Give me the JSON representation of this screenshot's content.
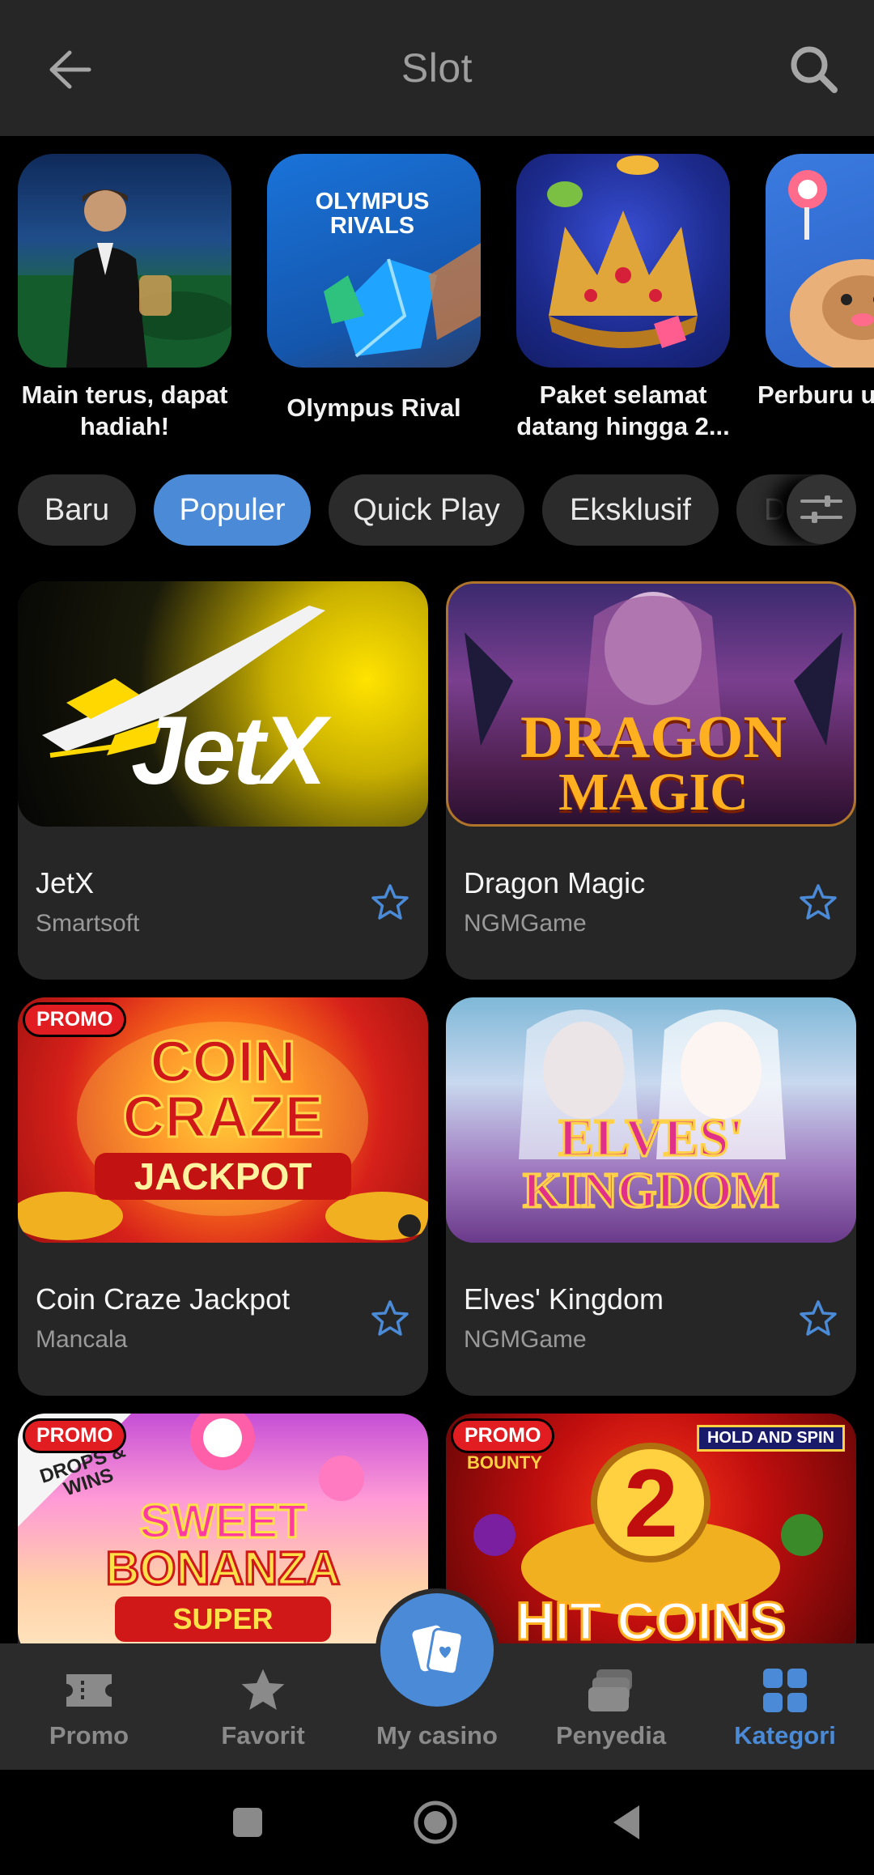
{
  "header": {
    "title": "Slot",
    "back_icon": "arrow-left-icon",
    "search_icon": "search-icon"
  },
  "promos": [
    {
      "label": "Main terus, dapat hadiah!"
    },
    {
      "label": "Olympus Rival",
      "art_text": "OLYMPUS RIVALS"
    },
    {
      "label": "Paket selamat datang hingga 2..."
    },
    {
      "label": "Perburu untuk pu"
    }
  ],
  "chips": [
    {
      "label": "Baru",
      "active": false
    },
    {
      "label": "Populer",
      "active": true
    },
    {
      "label": "Quick Play",
      "active": false
    },
    {
      "label": "Eksklusif",
      "active": false
    },
    {
      "label": "D",
      "active": false
    }
  ],
  "filter_icon": "sliders-icon",
  "games": [
    {
      "name": "JetX",
      "provider": "Smartsoft",
      "promo": false,
      "art_text": "JetX"
    },
    {
      "name": "Dragon Magic",
      "provider": "NGMGame",
      "promo": false,
      "art_line1": "DRAGON",
      "art_line2": "MAGIC"
    },
    {
      "name": "Coin Craze Jackpot",
      "provider": "Mancala",
      "promo": true,
      "art_line1": "COIN",
      "art_line2": "CRAZE",
      "art_line3": "JACKPOT"
    },
    {
      "name": "Elves' Kingdom",
      "provider": "NGMGame",
      "promo": false,
      "art_line1": "ELVES'",
      "art_line2": "KINGDOM"
    },
    {
      "name": "",
      "provider": "",
      "promo": true,
      "art_line1": "SWEET",
      "art_line2": "BONANZA",
      "art_line3": "SUPER SCATTER",
      "art_tag": "DROPS & WINS"
    },
    {
      "name": "",
      "provider": "",
      "promo": true,
      "art_line1": "HIT COINS",
      "art_tag": "HOLD AND SPIN",
      "art_tag2": "BOUNTY",
      "art_num": "2"
    }
  ],
  "promo_badge": "PROMO",
  "colors": {
    "accent": "#4a8ad6",
    "promo": "#e11d22",
    "card": "#262626",
    "header": "#262626"
  },
  "nav": [
    {
      "label": "Promo",
      "icon": "ticket-icon",
      "active": false
    },
    {
      "label": "Favorit",
      "icon": "star-icon",
      "active": false
    },
    {
      "label": "My casino",
      "icon": "cards-icon",
      "active": false
    },
    {
      "label": "Penyedia",
      "icon": "stack-icon",
      "active": false
    },
    {
      "label": "Kategori",
      "icon": "grid-icon",
      "active": true
    }
  ],
  "system_nav": [
    "recents-icon",
    "home-icon",
    "back-icon"
  ]
}
